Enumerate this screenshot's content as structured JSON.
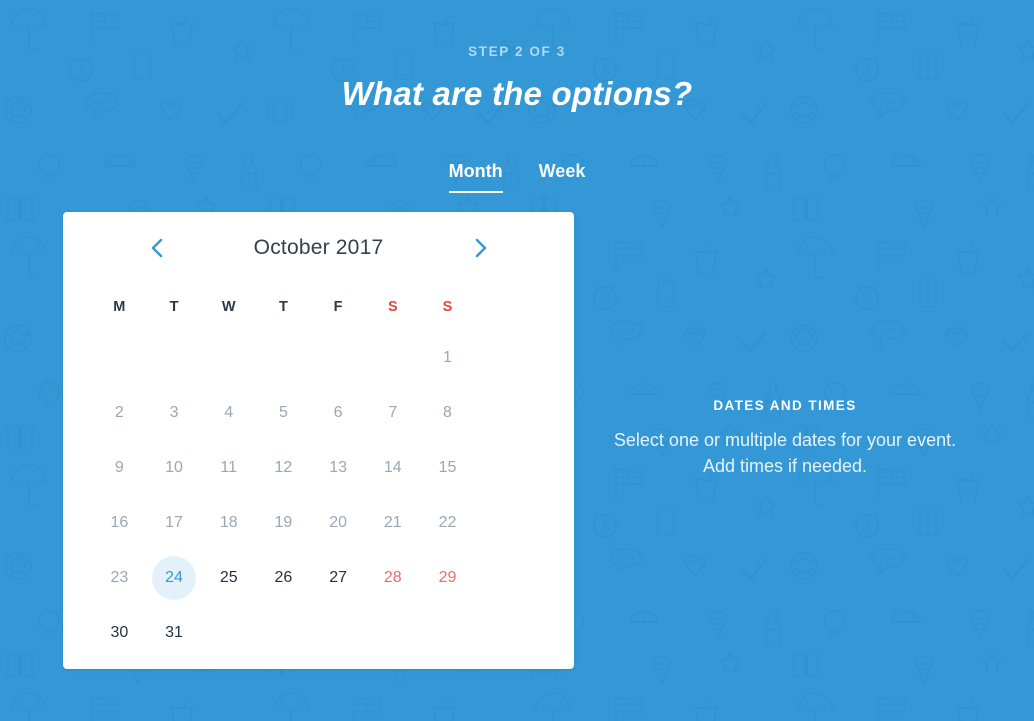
{
  "theme": {
    "background_color": "#3498d6",
    "card_color": "#ffffff",
    "accent_color": "#3498d6",
    "weekend_color": "#e8453c",
    "past_day_color": "#9aa7b4",
    "future_day_color": "#233344",
    "today_bg_color": "#e3f2fa"
  },
  "header": {
    "step_label": "STEP 2 OF 3",
    "title": "What are the options?"
  },
  "tabs": [
    {
      "label": "Month",
      "active": true
    },
    {
      "label": "Week",
      "active": false
    }
  ],
  "calendar": {
    "prev_icon": "chevron-left-icon",
    "next_icon": "chevron-right-icon",
    "month_title": "October 2017",
    "weekday_headers": [
      {
        "label": "M",
        "weekend": false
      },
      {
        "label": "T",
        "weekend": false
      },
      {
        "label": "W",
        "weekend": false
      },
      {
        "label": "T",
        "weekend": false
      },
      {
        "label": "F",
        "weekend": false
      },
      {
        "label": "S",
        "weekend": true
      },
      {
        "label": "S",
        "weekend": true
      }
    ],
    "weeks": [
      [
        {
          "label": "",
          "state": "empty"
        },
        {
          "label": "",
          "state": "empty"
        },
        {
          "label": "",
          "state": "empty"
        },
        {
          "label": "",
          "state": "empty"
        },
        {
          "label": "",
          "state": "empty"
        },
        {
          "label": "",
          "state": "empty"
        },
        {
          "label": "1",
          "state": "past"
        }
      ],
      [
        {
          "label": "2",
          "state": "past"
        },
        {
          "label": "3",
          "state": "past"
        },
        {
          "label": "4",
          "state": "past"
        },
        {
          "label": "5",
          "state": "past"
        },
        {
          "label": "6",
          "state": "past"
        },
        {
          "label": "7",
          "state": "past"
        },
        {
          "label": "8",
          "state": "past"
        }
      ],
      [
        {
          "label": "9",
          "state": "past"
        },
        {
          "label": "10",
          "state": "past"
        },
        {
          "label": "11",
          "state": "past"
        },
        {
          "label": "12",
          "state": "past"
        },
        {
          "label": "13",
          "state": "past"
        },
        {
          "label": "14",
          "state": "past"
        },
        {
          "label": "15",
          "state": "past"
        }
      ],
      [
        {
          "label": "16",
          "state": "past"
        },
        {
          "label": "17",
          "state": "past"
        },
        {
          "label": "18",
          "state": "past"
        },
        {
          "label": "19",
          "state": "past"
        },
        {
          "label": "20",
          "state": "past"
        },
        {
          "label": "21",
          "state": "past"
        },
        {
          "label": "22",
          "state": "past"
        }
      ],
      [
        {
          "label": "23",
          "state": "past"
        },
        {
          "label": "24",
          "state": "today"
        },
        {
          "label": "25",
          "state": "future"
        },
        {
          "label": "26",
          "state": "future"
        },
        {
          "label": "27",
          "state": "future"
        },
        {
          "label": "28",
          "state": "weekend-future"
        },
        {
          "label": "29",
          "state": "weekend-future"
        }
      ],
      [
        {
          "label": "30",
          "state": "future"
        },
        {
          "label": "31",
          "state": "future"
        },
        {
          "label": "",
          "state": "empty"
        },
        {
          "label": "",
          "state": "empty"
        },
        {
          "label": "",
          "state": "empty"
        },
        {
          "label": "",
          "state": "empty"
        },
        {
          "label": "",
          "state": "empty"
        }
      ]
    ]
  },
  "info_panel": {
    "title": "DATES AND TIMES",
    "description": "Select one or multiple dates for your event. Add times if needed."
  }
}
